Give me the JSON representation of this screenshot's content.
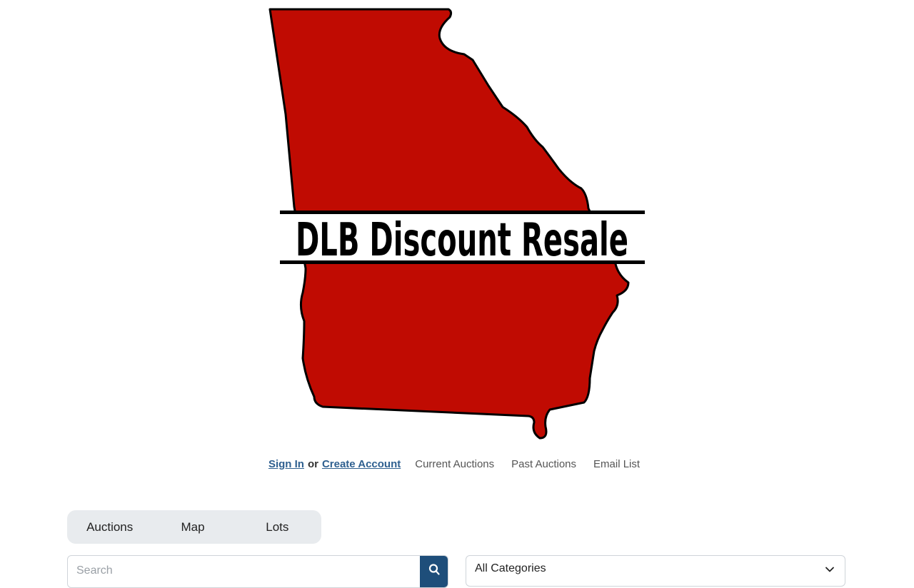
{
  "brand": {
    "logo_text": "DLB Discount Resale",
    "map_fill": "#c00b02",
    "outline_color": "#000000"
  },
  "auth": {
    "sign_in": "Sign In",
    "or": "or",
    "create_account": "Create Account",
    "link_color": "#2f6090"
  },
  "nav": {
    "current_auctions": "Current Auctions",
    "past_auctions": "Past Auctions",
    "email_list": "Email List"
  },
  "tabs": [
    {
      "label": "Auctions"
    },
    {
      "label": "Map"
    },
    {
      "label": "Lots"
    }
  ],
  "search": {
    "placeholder": "Search",
    "value": "",
    "icon": "search-icon",
    "button_color": "#1e4e7a"
  },
  "category_filter": {
    "selected": "All Categories",
    "icon": "chevron-down-icon"
  }
}
